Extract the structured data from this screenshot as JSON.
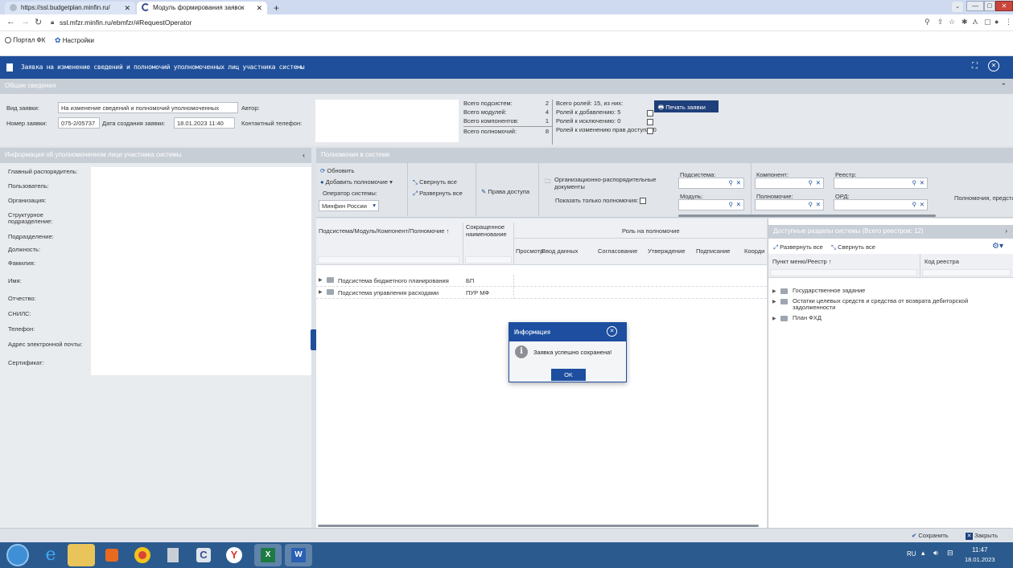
{
  "browser": {
    "tabs": [
      {
        "title": "https://ssl.budgetplan.minfin.ru/"
      },
      {
        "title": "Модуль формирования заявок"
      }
    ],
    "url": "ssl.mfzr.minfin.ru/ebmfzr/#RequestOperator",
    "bookmarks": [
      "Портал ФК",
      "Настройки"
    ]
  },
  "app": {
    "title": "Заявка на изменение сведений и полномочий уполномоченных лиц участника системы",
    "general": {
      "section": "Общие сведения",
      "request_type_label": "Вид заявки:",
      "request_type_value": "На изменение сведений и полномочий уполномоченных",
      "number_label": "Номер заявки:",
      "number_value": "075-2/05737",
      "created_label": "Дата создания заявки:",
      "created_value": "18.01.2023 11:40",
      "author_label": "Автор:",
      "phone_label": "Контактный телефон:",
      "stats": [
        {
          "label": "Всего подсистем:",
          "value": "2"
        },
        {
          "label": "Всего модулей:",
          "value": "4"
        },
        {
          "label": "Всего компонентов:",
          "value": "1"
        },
        {
          "label": "Всего полномочий:",
          "value": "8"
        }
      ],
      "roles_total": "Всего ролей: 15, из них:",
      "roles": [
        "Ролей к добавлению: 5",
        "Ролей к исключению: 0",
        "Ролей к изменению прав доступа: 0"
      ],
      "print_button": "Печать заявки"
    },
    "left_panel": {
      "title": "Информация об уполномоченном лице участника системы",
      "fields": [
        "Главный распорядитель:",
        "Пользователь:",
        "Организация:",
        "Структурное подразделение:",
        "Подразделение:",
        "Должность:",
        "Фамилия:",
        "Имя:",
        "Отчество:",
        "СНИЛС:",
        "Телефон:",
        "Адрес электронной почты:",
        "Сертификат:"
      ]
    },
    "permissions": {
      "title": "Полномочия в системе",
      "refresh": "Обновить",
      "add": "Добавить полномочие",
      "operator_label": "Оператор системы:",
      "operator_value": "Минфин России",
      "collapse_all": "Свернуть все",
      "expand_all": "Развернуть все",
      "access_rights": "Права доступа",
      "org_docs": "Организационно-распорядительные документы",
      "only_perms": "Показать только полномочия:",
      "subsystem": "Подсистема:",
      "module": "Модуль:",
      "component": "Компонент:",
      "authority": "Полномочие:",
      "registry": "Реестр:",
      "ord": "ОРД:",
      "perms_cut": "Полномочия, предста",
      "col_main": "Подсистема/Модуль/Компонент/Полномочие",
      "col_short": "Сокращенное наименование",
      "col_role": "Роль на полномочие",
      "role_cols": [
        "Просмотр",
        "Ввод данных",
        "Согласование",
        "Утверждение",
        "Подписание",
        "Коорди"
      ],
      "rows": [
        {
          "name": "Подсистема бюджетного планирования",
          "short": "БП"
        },
        {
          "name": "Подсистема управления расходами",
          "short": "ПУР МФ"
        }
      ]
    },
    "sections_panel": {
      "title": "Доступные разделы системы (Всего реестров: 12)",
      "expand_all": "Развернуть все",
      "collapse_all": "Свернуть все",
      "col_menu": "Пункт меню/Реестр",
      "col_code": "Код реестра",
      "items": [
        "Государственное задание",
        "Остатки целевых средств и средства от возврата дебиторской задолженности",
        "План ФХД"
      ]
    },
    "dialog": {
      "title": "Информация",
      "message": "Заявка успешно сохранена!",
      "ok": "OK"
    },
    "footer": {
      "save": "Сохранить",
      "close": "Закрыть"
    }
  },
  "taskbar": {
    "lang": "RU",
    "time": "11:47",
    "date": "18.01.2023"
  },
  "colors": {
    "header_blue": "#1f4f9a",
    "dialog_blue": "#1d4ea0",
    "section_gray": "#c8ced6"
  }
}
